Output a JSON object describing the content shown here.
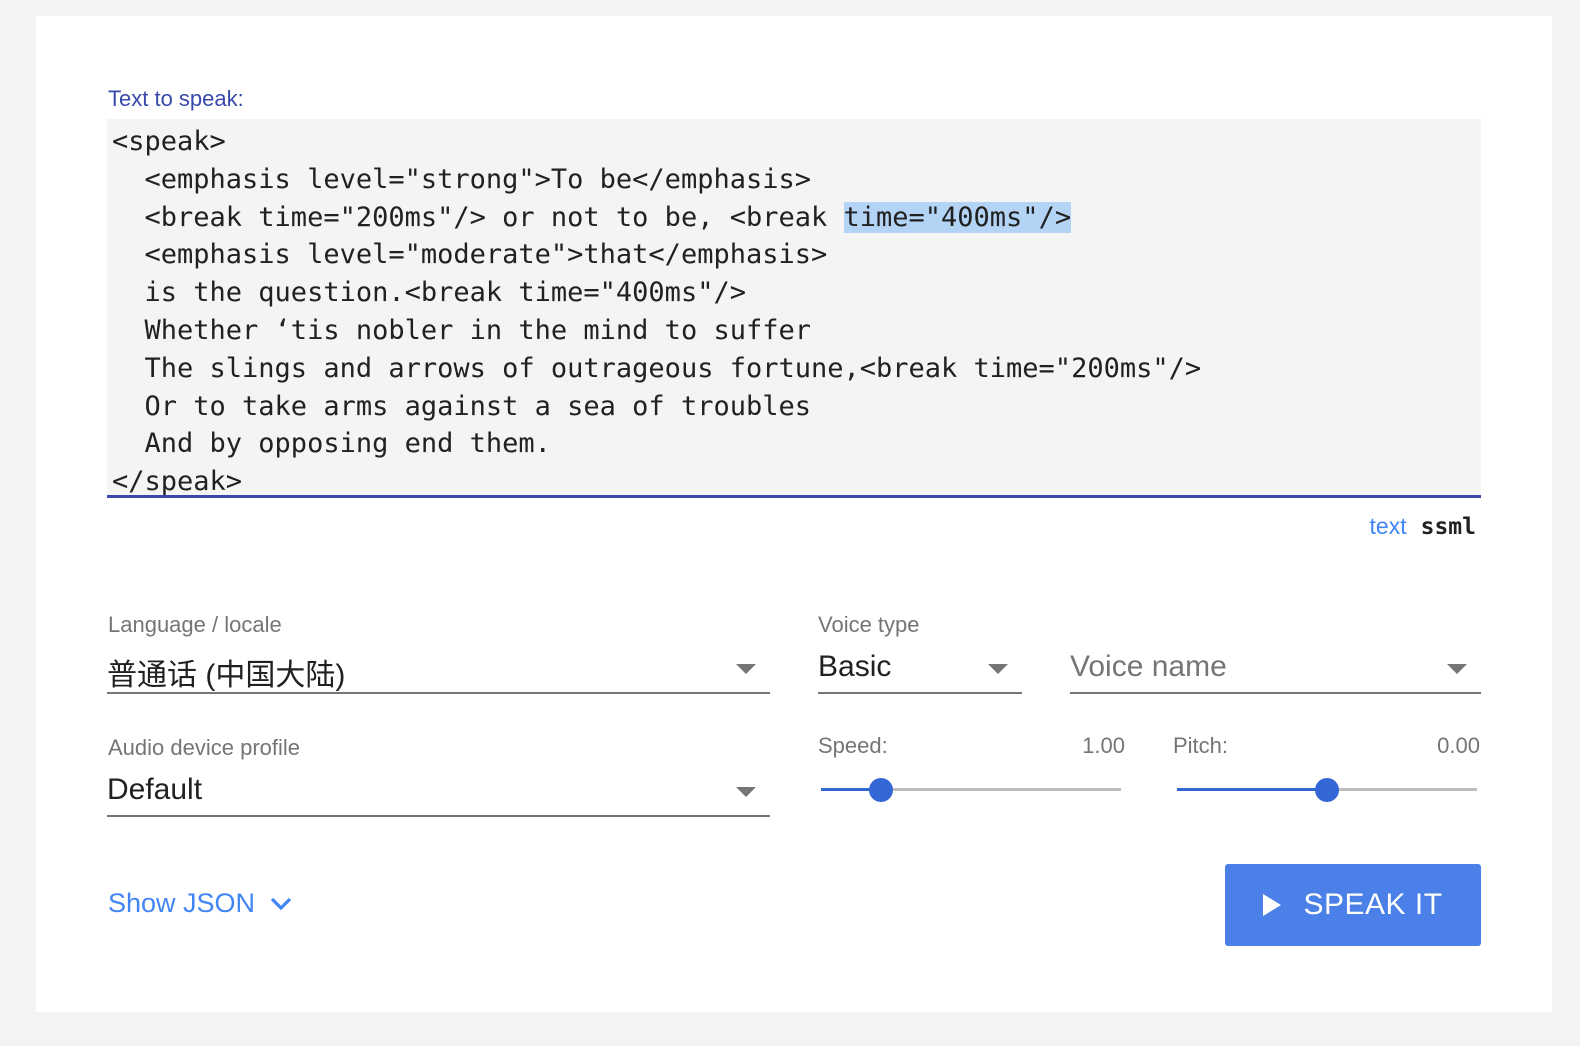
{
  "input": {
    "label": "Text to speak:",
    "lines": [
      "<speak>",
      "  <emphasis level=\"strong\">To be</emphasis>",
      "  <break time=\"200ms\"/> or not to be, <break ",
      "  <emphasis level=\"moderate\">that</emphasis>",
      "  is the question.<break time=\"400ms\"/>",
      "  Whether ‘tis nobler in the mind to suffer",
      "  The slings and arrows of outrageous fortune,<break time=\"200ms\"/>",
      "  Or to take arms against a sea of troubles",
      "  And by opposing end them.",
      "</speak>"
    ],
    "selected_text": "time=\"400ms\"/>"
  },
  "mode": {
    "text_label": "text",
    "ssml_label": "ssml",
    "active": "ssml"
  },
  "language": {
    "label": "Language / locale",
    "value": "普通话 (中国大陆)"
  },
  "voice_type": {
    "label": "Voice type",
    "value": "Basic"
  },
  "voice_name": {
    "placeholder": "Voice name"
  },
  "audio_profile": {
    "label": "Audio device profile",
    "value": "Default"
  },
  "speed": {
    "label": "Speed:",
    "value_text": "1.00",
    "fraction": 0.2
  },
  "pitch": {
    "label": "Pitch:",
    "value_text": "0.00",
    "fraction": 0.5
  },
  "show_json": {
    "label": "Show JSON"
  },
  "speak_button": {
    "label": "SPEAK IT"
  },
  "colors": {
    "accent": "#3949ab",
    "link": "#4285f4",
    "button": "#4a80e8",
    "slider": "#3367d6"
  }
}
